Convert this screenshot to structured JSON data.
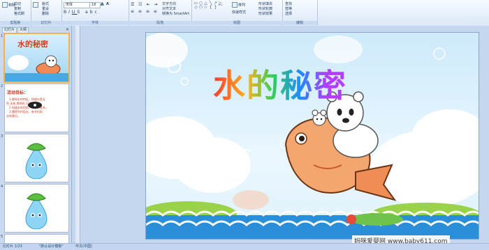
{
  "ribbon": {
    "groups": [
      "剪贴板",
      "幻灯片",
      "字体",
      "段落",
      "绘图",
      "编辑"
    ],
    "clipboard": {
      "paste": "粘贴",
      "cut": "剪切",
      "copy": "复制",
      "format_painter": "格式刷"
    },
    "slides": {
      "new_slide": "新建幻灯片",
      "layout": "版式",
      "reset": "重设",
      "delete": "删除"
    },
    "font": {
      "font_name": "宋体",
      "font_size": "18"
    },
    "paragraph": {
      "text_direction": "文字方向",
      "align_text": "对齐文本",
      "smartart": "转换为 SmartArt"
    },
    "drawing": {
      "arrange": "排列",
      "quick_styles": "快速样式",
      "fill": "形状填充",
      "outline": "形状轮廓",
      "effects": "形状效果"
    },
    "editing": {
      "find": "查找",
      "replace": "替换",
      "select": "选择"
    }
  },
  "pane": {
    "tab_slides": "幻灯片",
    "tab_outline": "大纲",
    "close": "×"
  },
  "thumbnails": {
    "t1_title": "水的秘密",
    "t2_title": "活动目标：",
    "t2_lines": [
      "1.感知水的特征，知道水是无",
      "色 无味 透明的 可流动的。",
      "2.知道水的用处，和水的关系。",
      "3.懂得节约用水，有节约用",
      "水的意识。"
    ],
    "numbers": [
      "1",
      "2",
      "3",
      "4",
      "5"
    ]
  },
  "slide": {
    "title": "水的秘密"
  },
  "watermark": "妈咪爱婴网 www.baby611.com",
  "status": {
    "slide_info": "幻灯片 1/23",
    "theme": "\"默认设计模板\"",
    "language": "中文(中国)"
  },
  "colors": {
    "ribbon_bg": "#dbe8f7",
    "pane_bg": "#c9daf0",
    "slide_sky": "#cdeafb",
    "wave": "#2a8fd8",
    "bear_bg": "#f3a66d"
  }
}
